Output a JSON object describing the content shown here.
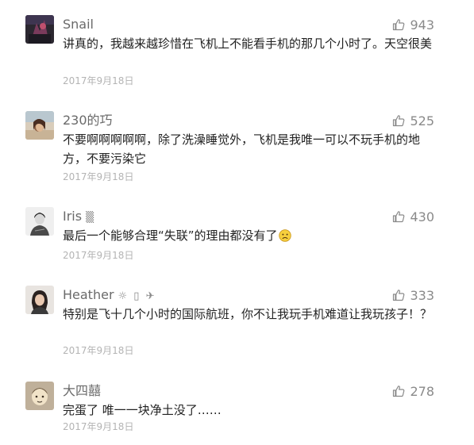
{
  "comments": [
    {
      "user": "Snail",
      "name_suffix": "",
      "likes": "943",
      "text": "讲真的，我越来越珍惜在飞机上不能看手机的那几个小时了。天空很美",
      "date": "2017年9月18日",
      "avatar_icon": "avatar-dark-photo"
    },
    {
      "user": "230的巧",
      "name_suffix": "",
      "likes": "525",
      "text": "不要啊啊啊啊啊，除了洗澡睡觉外，飞机是我唯一可以不玩手机的地方，不要污染它",
      "date": "2017年9月18日",
      "avatar_icon": "avatar-beach-photo"
    },
    {
      "user": "Iris",
      "name_suffix": "▒",
      "likes": "430",
      "text": "最后一个能够合理“失联”的理由都没有了",
      "date": "2017年9月18日",
      "avatar_icon": "avatar-sketch-photo",
      "emoji_icon": "sad-face-icon"
    },
    {
      "user": "Heather",
      "name_suffix": "☼ ▯ ✈",
      "likes": "333",
      "text": "特别是飞十几个小时的国际航班，你不让我玩手机难道让我玩孩子！？",
      "date": "2017年9月18日",
      "avatar_icon": "avatar-portrait-photo"
    },
    {
      "user": "大四囍",
      "name_suffix": "",
      "likes": "278",
      "text": "完蛋了 唯一一块净土没了……",
      "date": "2017年9月18日",
      "avatar_icon": "avatar-cartoon-photo"
    }
  ],
  "colors": {
    "name": "#6a6a6a",
    "text": "#222222",
    "date": "#b4b4b4",
    "like": "#8a8a8a"
  }
}
